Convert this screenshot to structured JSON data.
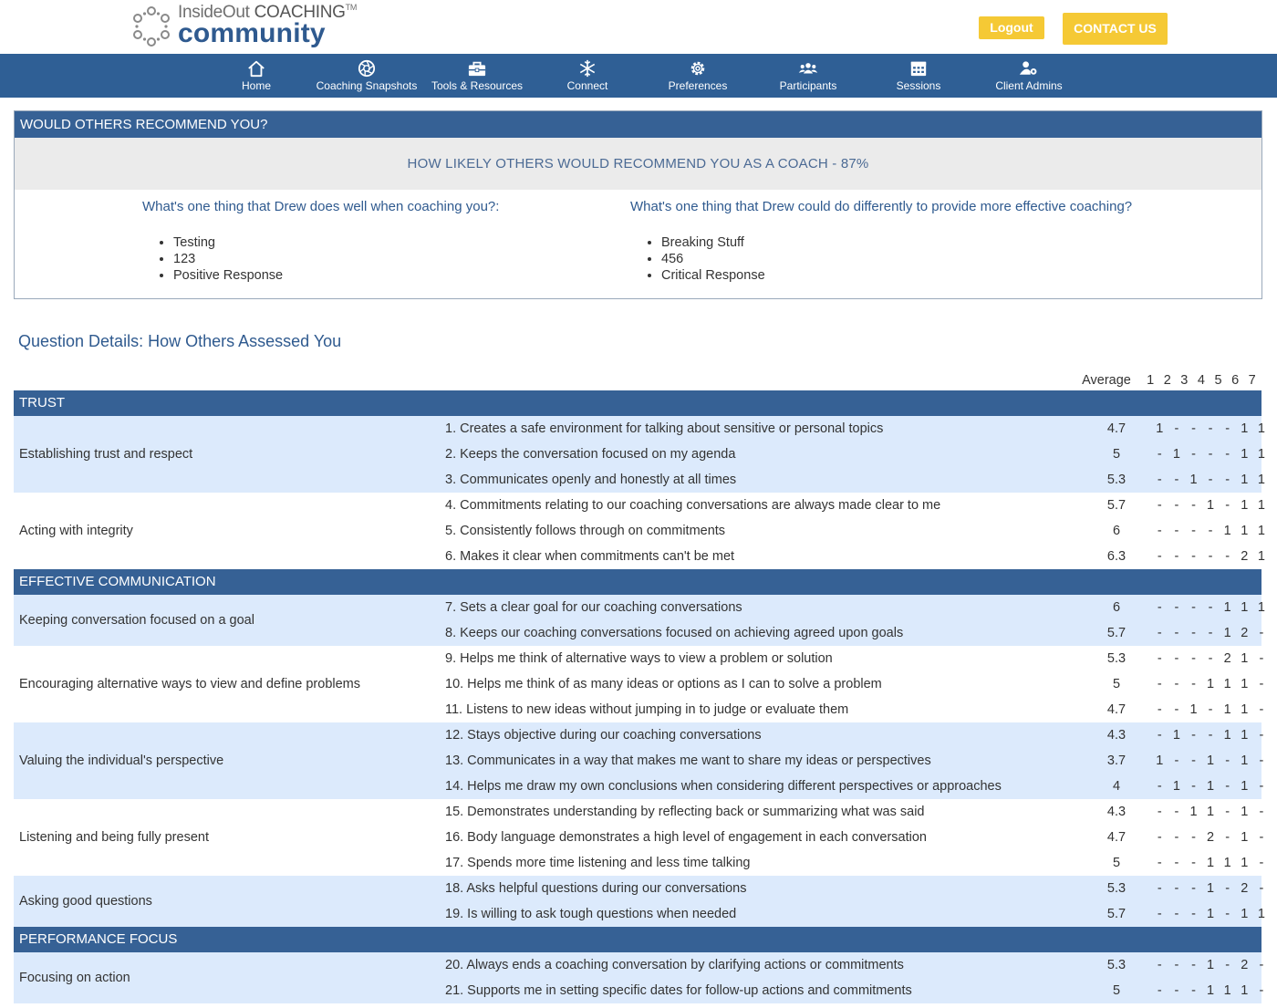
{
  "header": {
    "logo_top_light": "InsideOut",
    "logo_top_bold": "COACHING",
    "logo_tm": "TM",
    "logo_bottom": "community",
    "logout_label": "Logout",
    "contact_label": "CONTACT US",
    "accent_color": "#f5c935",
    "brand_color": "#2f5f95"
  },
  "nav": {
    "items": [
      {
        "label": "Home",
        "icon": "home-icon"
      },
      {
        "label": "Coaching Snapshots",
        "icon": "aperture-icon"
      },
      {
        "label": "Tools & Resources",
        "icon": "toolbox-icon"
      },
      {
        "label": "Connect",
        "icon": "snowflake-icon"
      },
      {
        "label": "Preferences",
        "icon": "gear-icon"
      },
      {
        "label": "Participants",
        "icon": "users-icon"
      },
      {
        "label": "Sessions",
        "icon": "calendar-icon"
      },
      {
        "label": "Client Admins",
        "icon": "user-gear-icon"
      }
    ]
  },
  "recommend": {
    "heading": "WOULD OTHERS RECOMMEND YOU?",
    "score_text": "HOW LIKELY OTHERS WOULD RECOMMEND YOU AS A COACH - 87%",
    "well": {
      "question": "What's one thing that Drew does well when coaching you?:",
      "answers": [
        "Testing",
        "123",
        "Positive Response"
      ]
    },
    "differently": {
      "question": "What's one thing that Drew could do differently to provide more effective coaching?",
      "answers": [
        "Breaking Stuff",
        "456",
        "Critical Response"
      ]
    }
  },
  "details": {
    "title": "Question Details: How Others Assessed You",
    "avg_label": "Average",
    "scale": [
      "1",
      "2",
      "3",
      "4",
      "5",
      "6",
      "7"
    ],
    "sections": [
      {
        "name": "TRUST",
        "groups": [
          {
            "competency": "Establishing trust and respect",
            "questions": [
              {
                "text": "1. Creates a safe environment for talking about sensitive or personal topics",
                "avg": "4.7",
                "counts": [
                  "1",
                  "-",
                  "-",
                  "-",
                  "-",
                  "1",
                  "1"
                ]
              },
              {
                "text": "2. Keeps the conversation focused on my agenda",
                "avg": "5",
                "counts": [
                  "-",
                  "1",
                  "-",
                  "-",
                  "-",
                  "1",
                  "1"
                ]
              },
              {
                "text": "3. Communicates openly and honestly at all times",
                "avg": "5.3",
                "counts": [
                  "-",
                  "-",
                  "1",
                  "-",
                  "-",
                  "1",
                  "1"
                ]
              }
            ]
          },
          {
            "competency": "Acting with integrity",
            "questions": [
              {
                "text": "4. Commitments relating to our coaching conversations are always made clear to me",
                "avg": "5.7",
                "counts": [
                  "-",
                  "-",
                  "-",
                  "1",
                  "-",
                  "1",
                  "1"
                ]
              },
              {
                "text": "5. Consistently follows through on commitments",
                "avg": "6",
                "counts": [
                  "-",
                  "-",
                  "-",
                  "-",
                  "1",
                  "1",
                  "1"
                ]
              },
              {
                "text": "6. Makes it clear when commitments can't be met",
                "avg": "6.3",
                "counts": [
                  "-",
                  "-",
                  "-",
                  "-",
                  "-",
                  "2",
                  "1"
                ]
              }
            ]
          }
        ]
      },
      {
        "name": "EFFECTIVE COMMUNICATION",
        "groups": [
          {
            "competency": "Keeping conversation focused on a goal",
            "questions": [
              {
                "text": "7. Sets a clear goal for our coaching conversations",
                "avg": "6",
                "counts": [
                  "-",
                  "-",
                  "-",
                  "-",
                  "1",
                  "1",
                  "1"
                ]
              },
              {
                "text": "8. Keeps our coaching conversations focused on achieving agreed upon goals",
                "avg": "5.7",
                "counts": [
                  "-",
                  "-",
                  "-",
                  "-",
                  "1",
                  "2",
                  "-"
                ]
              }
            ]
          },
          {
            "competency": "Encouraging alternative ways to view and define problems",
            "questions": [
              {
                "text": "9. Helps me think of alternative ways to view a problem or solution",
                "avg": "5.3",
                "counts": [
                  "-",
                  "-",
                  "-",
                  "-",
                  "2",
                  "1",
                  "-"
                ]
              },
              {
                "text": "10. Helps me think of as many ideas or options as I can to solve a problem",
                "avg": "5",
                "counts": [
                  "-",
                  "-",
                  "-",
                  "1",
                  "1",
                  "1",
                  "-"
                ]
              },
              {
                "text": "11. Listens to new ideas without jumping in to judge or evaluate them",
                "avg": "4.7",
                "counts": [
                  "-",
                  "-",
                  "1",
                  "-",
                  "1",
                  "1",
                  "-"
                ]
              }
            ]
          },
          {
            "competency": "Valuing the individual's perspective",
            "questions": [
              {
                "text": "12. Stays objective during our coaching conversations",
                "avg": "4.3",
                "counts": [
                  "-",
                  "1",
                  "-",
                  "-",
                  "1",
                  "1",
                  "-"
                ]
              },
              {
                "text": "13. Communicates in a way that makes me want to share my ideas or perspectives",
                "avg": "3.7",
                "counts": [
                  "1",
                  "-",
                  "-",
                  "1",
                  "-",
                  "1",
                  "-"
                ]
              },
              {
                "text": "14. Helps me draw my own conclusions when considering different perspectives or approaches",
                "avg": "4",
                "counts": [
                  "-",
                  "1",
                  "-",
                  "1",
                  "-",
                  "1",
                  "-"
                ]
              }
            ]
          },
          {
            "competency": "Listening and being fully present",
            "questions": [
              {
                "text": "15. Demonstrates understanding by reflecting back or summarizing what was said",
                "avg": "4.3",
                "counts": [
                  "-",
                  "-",
                  "1",
                  "1",
                  "-",
                  "1",
                  "-"
                ]
              },
              {
                "text": "16. Body language demonstrates a high level of engagement in each conversation",
                "avg": "4.7",
                "counts": [
                  "-",
                  "-",
                  "-",
                  "2",
                  "-",
                  "1",
                  "-"
                ]
              },
              {
                "text": "17. Spends more time listening and less time talking",
                "avg": "5",
                "counts": [
                  "-",
                  "-",
                  "-",
                  "1",
                  "1",
                  "1",
                  "-"
                ]
              }
            ]
          },
          {
            "competency": "Asking good questions",
            "questions": [
              {
                "text": "18. Asks helpful questions during our conversations",
                "avg": "5.3",
                "counts": [
                  "-",
                  "-",
                  "-",
                  "1",
                  "-",
                  "2",
                  "-"
                ]
              },
              {
                "text": "19. Is willing to ask tough questions when needed",
                "avg": "5.7",
                "counts": [
                  "-",
                  "-",
                  "-",
                  "1",
                  "-",
                  "1",
                  "1"
                ]
              }
            ]
          }
        ]
      },
      {
        "name": "PERFORMANCE FOCUS",
        "groups": [
          {
            "competency": "Focusing on action",
            "questions": [
              {
                "text": "20. Always ends a coaching conversation by clarifying actions or commitments",
                "avg": "5.3",
                "counts": [
                  "-",
                  "-",
                  "-",
                  "1",
                  "-",
                  "2",
                  "-"
                ]
              },
              {
                "text": "21. Supports me in setting specific dates for follow-up actions and commitments",
                "avg": "5",
                "counts": [
                  "-",
                  "-",
                  "-",
                  "1",
                  "1",
                  "1",
                  "-"
                ]
              }
            ]
          }
        ]
      }
    ]
  }
}
